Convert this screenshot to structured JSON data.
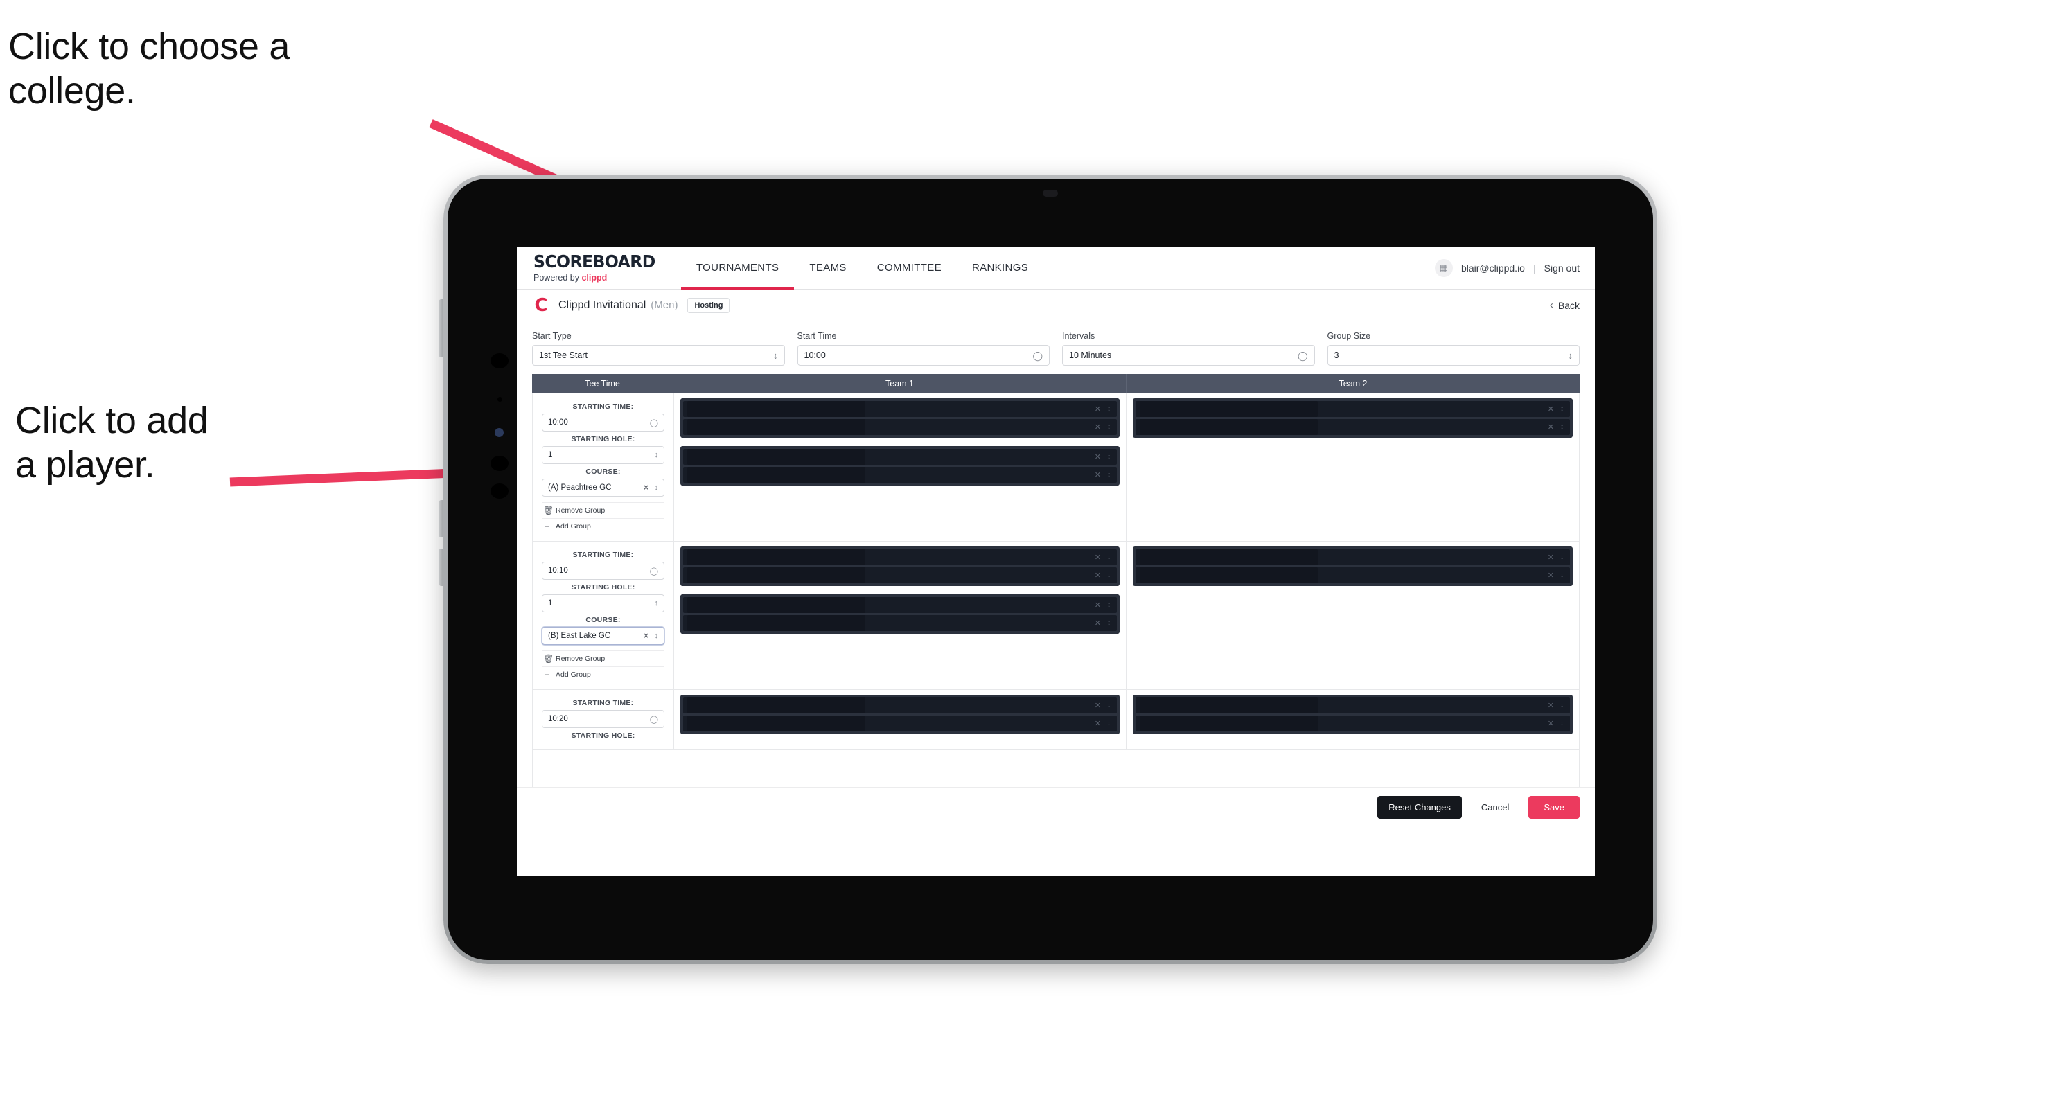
{
  "callouts": [
    {
      "text": "Click to choose a\ncollege."
    },
    {
      "text": "Click to add\na player."
    }
  ],
  "colors": {
    "accent_pink": "#ec3a5e",
    "nav_underline": "#e0264c",
    "table_header_bg": "#4e5565",
    "player_block_bg": "#2b313d",
    "player_slot_bg": "#171c26",
    "reset_button_bg": "#15181d",
    "arrow_pink": "#ec3a5e"
  },
  "nav": {
    "brand_title": "SCOREBOARD",
    "brand_sub_prefix": "Powered by ",
    "brand_sub_name": "clippd",
    "tabs": [
      {
        "label": "TOURNAMENTS",
        "active": true
      },
      {
        "label": "TEAMS",
        "active": false
      },
      {
        "label": "COMMITTEE",
        "active": false
      },
      {
        "label": "RANKINGS",
        "active": false
      }
    ],
    "avatar_icon": "user-badge-icon",
    "email": "blair@clippd.io",
    "separator": "|",
    "signout": "Sign out"
  },
  "tournament": {
    "logo_letter": "C",
    "name": "Clippd Invitational",
    "gender": "(Men)",
    "badge": "Hosting",
    "back_label": "Back",
    "back_icon": "chevron-left-icon"
  },
  "settings": {
    "fields": [
      {
        "label": "Start Type",
        "value": "1st Tee Start",
        "adorn": "stepper-icon"
      },
      {
        "label": "Start Time",
        "value": "10:00",
        "adorn": "clock-icon"
      },
      {
        "label": "Intervals",
        "value": "10 Minutes",
        "adorn": "clock-icon"
      },
      {
        "label": "Group Size",
        "value": "3",
        "adorn": "stepper-icon"
      }
    ]
  },
  "grid": {
    "headers": [
      "Tee Time",
      "Team 1",
      "Team 2"
    ],
    "labels": {
      "starting_time": "STARTING TIME:",
      "starting_hole": "STARTING HOLE:",
      "course": "COURSE:",
      "remove_group": "Remove Group",
      "add_group": "Add Group"
    },
    "rows": [
      {
        "starting_time": "10:00",
        "starting_hole": "1",
        "course": "(A) Peachtree GC",
        "course_focused": false,
        "team1_groups": [
          2,
          2
        ],
        "team2_groups": [
          2
        ]
      },
      {
        "starting_time": "10:10",
        "starting_hole": "1",
        "course": "(B) East Lake GC",
        "course_focused": true,
        "team1_groups": [
          2,
          2
        ],
        "team2_groups": [
          2
        ]
      },
      {
        "starting_time": "10:20",
        "starting_hole": "",
        "course": "",
        "course_focused": false,
        "team1_groups": [
          2
        ],
        "team2_groups": [
          2
        ]
      }
    ]
  },
  "footer": {
    "reset": "Reset Changes",
    "cancel": "Cancel",
    "save": "Save"
  }
}
